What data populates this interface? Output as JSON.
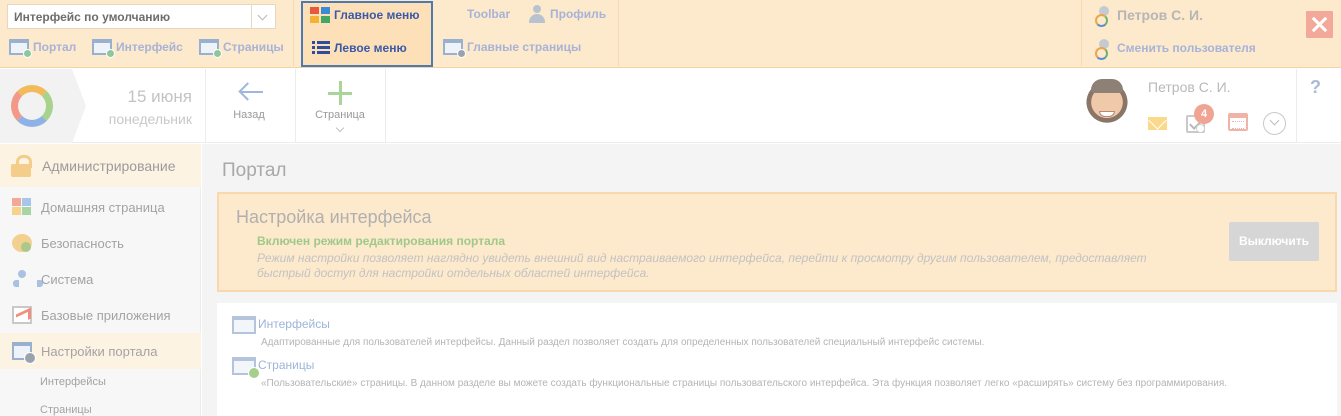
{
  "edit_toolbar": {
    "interface_select": {
      "value": "Интерфейс по умолчанию"
    },
    "links": {
      "portal": "Портал",
      "interface": "Интерфейс",
      "pages": "Страницы"
    },
    "main_menu": "Главное меню",
    "left_menu": "Левое меню",
    "toolbar": "Toolbar",
    "profile": "Профиль",
    "main_pages": "Главные страницы",
    "user_name": "Петров С. И.",
    "change_user": "Сменить пользователя"
  },
  "header": {
    "date_day": "15 июня",
    "date_weekday": "понедельник",
    "back_label": "Назад",
    "page_label": "Страница",
    "user_name": "Петров С. И.",
    "tasks_badge": "4",
    "help": "?"
  },
  "sidebar": {
    "admin_label": "Администрирование",
    "items": [
      {
        "label": "Домашняя страница",
        "icon": "home-grid-icon"
      },
      {
        "label": "Безопасность",
        "icon": "security-icon"
      },
      {
        "label": "Система",
        "icon": "system-icon"
      },
      {
        "label": "Базовые приложения",
        "icon": "apps-icon"
      },
      {
        "label": "Настройки портала",
        "icon": "portal-settings-icon"
      }
    ],
    "subitems": [
      "Интерфейсы",
      "Страницы"
    ]
  },
  "main": {
    "title": "Портал",
    "notice": {
      "title": "Настройка интерфейса",
      "status": "Включен режим редактирования портала",
      "description": "Режим настройки позволяет наглядно увидеть внешний вид настраиваемого интерфейса, перейти к просмотру другим пользователем, предоставляет быстрый доступ для настройки отдельных областей интерфейса.",
      "button": "Выключить"
    },
    "sections": [
      {
        "title": "Интерфейсы",
        "description": "Адаптированные для пользователей интерфейсы. Данный раздел позволяет создать для определенных пользователей специальный интерфейс системы."
      },
      {
        "title": "Страницы",
        "description": "«Пользовательские» страницы. В данном разделе вы можете создать функциональные страницы пользовательского интерфейса. Эта функция позволяет легко «расширять» систему без программирования."
      }
    ]
  },
  "colors": {
    "edit_bar_bg": "#fde9cc",
    "active_border": "#4d7bb1",
    "close_button": "#f2a99a",
    "status_green": "#9fc988"
  }
}
